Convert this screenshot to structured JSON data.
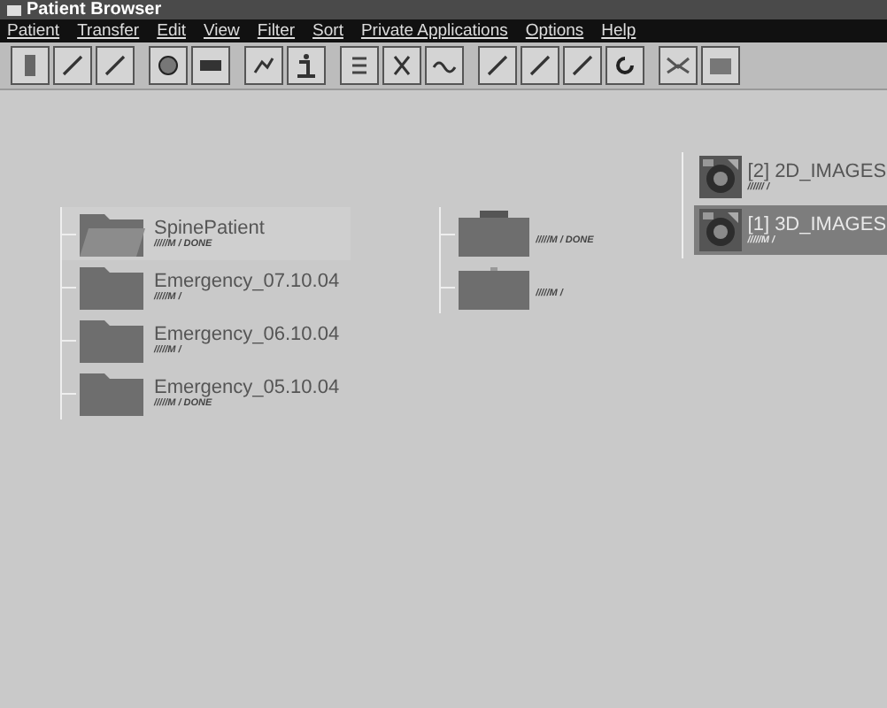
{
  "window": {
    "title": "Patient Browser"
  },
  "menu": [
    "Patient",
    "Transfer",
    "Edit",
    "View",
    "Filter",
    "Sort",
    "Private Applications",
    "Options",
    "Help"
  ],
  "patients": [
    {
      "name": "SpinePatient",
      "info": "/////M / DONE",
      "expanded": true,
      "children": [
        {
          "info": "/////M / DONE",
          "expanded": true,
          "children": [
            {
              "name": "[2] 2D_IMAGES",
              "info": "////// /",
              "selected": false
            },
            {
              "name": "[1] 3D_IMAGES",
              "info": "/////M /",
              "selected": true
            }
          ]
        },
        {
          "info": "/////M /",
          "expanded": false
        }
      ]
    },
    {
      "name": "Emergency_07.10.04",
      "info": "/////M /",
      "expanded": false
    },
    {
      "name": "Emergency_06.10.04",
      "info": "/////M /",
      "expanded": false
    },
    {
      "name": "Emergency_05.10.04",
      "info": "/////M / DONE",
      "expanded": false
    }
  ]
}
